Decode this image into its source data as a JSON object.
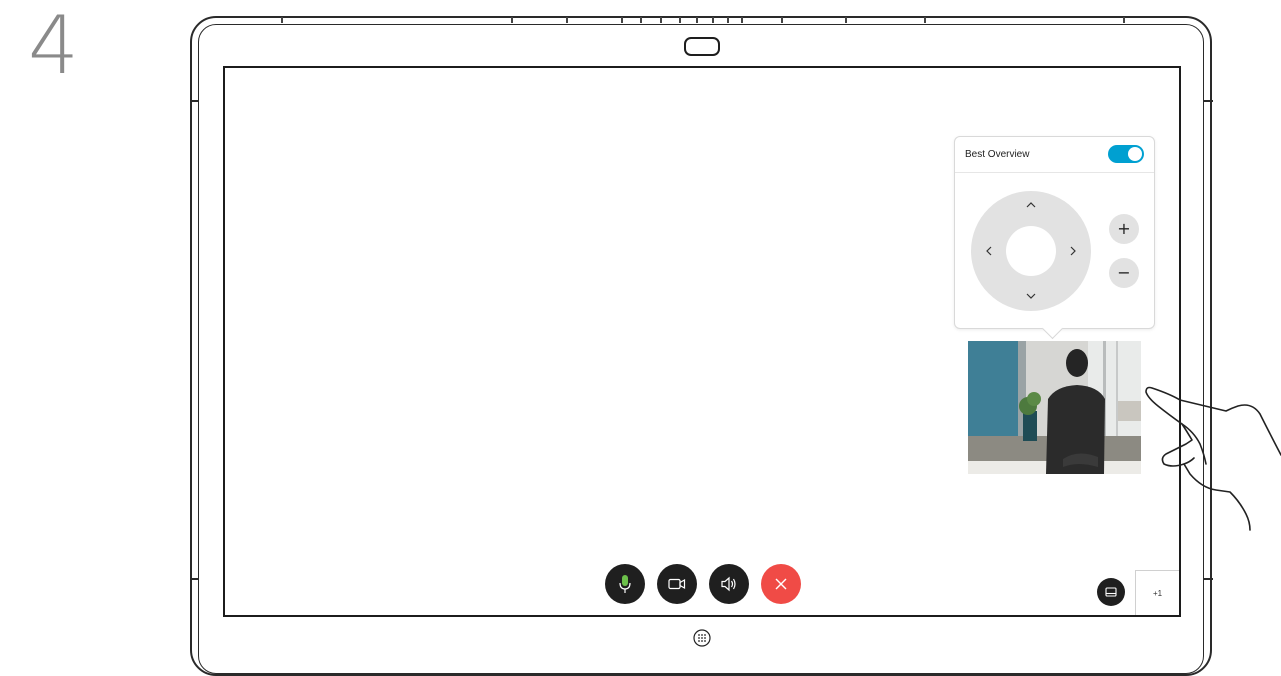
{
  "step": {
    "number": "4"
  },
  "camera_panel": {
    "best_overview_label": "Best Overview",
    "best_overview_enabled": true,
    "accent_color": "#00a0d1",
    "dpad": {
      "up": "^",
      "down": "v",
      "left": "<",
      "right": ">"
    },
    "zoom_in": "+",
    "zoom_out": "−"
  },
  "call_controls": {
    "mic_color": "#6cc04a",
    "end_call_color": "#f04b46",
    "icons": [
      "microphone-icon",
      "camera-icon",
      "speaker-icon",
      "close-icon"
    ]
  },
  "participants": {
    "more_label": "+1"
  }
}
